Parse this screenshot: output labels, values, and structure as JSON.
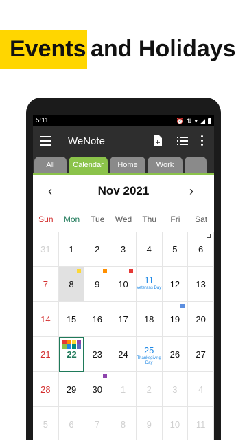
{
  "headline": {
    "word1": "Events",
    "word2": "and Holidays"
  },
  "status": {
    "time": "5:11"
  },
  "app": {
    "title": "WeNote"
  },
  "tabs": [
    {
      "label": "All",
      "active": false
    },
    {
      "label": "Calendar",
      "active": true
    },
    {
      "label": "Home",
      "active": false
    },
    {
      "label": "Work",
      "active": false
    }
  ],
  "calendar": {
    "month_label": "Nov 2021",
    "prev_label": "‹",
    "next_label": "›",
    "weekdays": [
      "Sun",
      "Mon",
      "Tue",
      "Wed",
      "Thu",
      "Fri",
      "Sat"
    ],
    "days": [
      {
        "d": "31",
        "other": true
      },
      {
        "d": "1"
      },
      {
        "d": "2"
      },
      {
        "d": "3"
      },
      {
        "d": "4"
      },
      {
        "d": "5"
      },
      {
        "d": "6",
        "dots": [
          "outline"
        ]
      },
      {
        "d": "7",
        "sun": true
      },
      {
        "d": "8",
        "selected": true,
        "dots": [
          "#fdd835"
        ]
      },
      {
        "d": "9",
        "dots": [
          "#ff8f00"
        ]
      },
      {
        "d": "10",
        "dots": [
          "#e53935"
        ]
      },
      {
        "d": "11",
        "holiday": "Veterans Day"
      },
      {
        "d": "12"
      },
      {
        "d": "13"
      },
      {
        "d": "14",
        "sun": true
      },
      {
        "d": "15"
      },
      {
        "d": "16"
      },
      {
        "d": "17"
      },
      {
        "d": "18"
      },
      {
        "d": "19",
        "dots": [
          "#5c8fe0"
        ]
      },
      {
        "d": "20"
      },
      {
        "d": "21",
        "sun": true
      },
      {
        "d": "22",
        "today": true
      },
      {
        "d": "23"
      },
      {
        "d": "24"
      },
      {
        "d": "25",
        "holiday": "Thanksgiving Day"
      },
      {
        "d": "26"
      },
      {
        "d": "27"
      },
      {
        "d": "28",
        "sun": true
      },
      {
        "d": "29"
      },
      {
        "d": "30",
        "dots": [
          "#8e44ad"
        ]
      },
      {
        "d": "1",
        "other": true
      },
      {
        "d": "2",
        "other": true
      },
      {
        "d": "3",
        "other": true
      },
      {
        "d": "4",
        "other": true
      },
      {
        "d": "5",
        "other": true
      },
      {
        "d": "6",
        "other": true
      },
      {
        "d": "7",
        "other": true
      },
      {
        "d": "8",
        "other": true
      },
      {
        "d": "9",
        "other": true
      },
      {
        "d": "10",
        "other": true
      },
      {
        "d": "11",
        "other": true
      }
    ],
    "today_colors": [
      "#e53935",
      "#ff8f00",
      "#fdd835",
      "#8e44ad",
      "#8bc34a",
      "#1e88e5",
      "#00897b",
      "#5c6bc0"
    ]
  },
  "colors": {
    "accent": "#8bc34a",
    "appbar": "#2e2e2e",
    "headline_highlight": "#ffd600",
    "today_border": "#1f7a5a"
  }
}
